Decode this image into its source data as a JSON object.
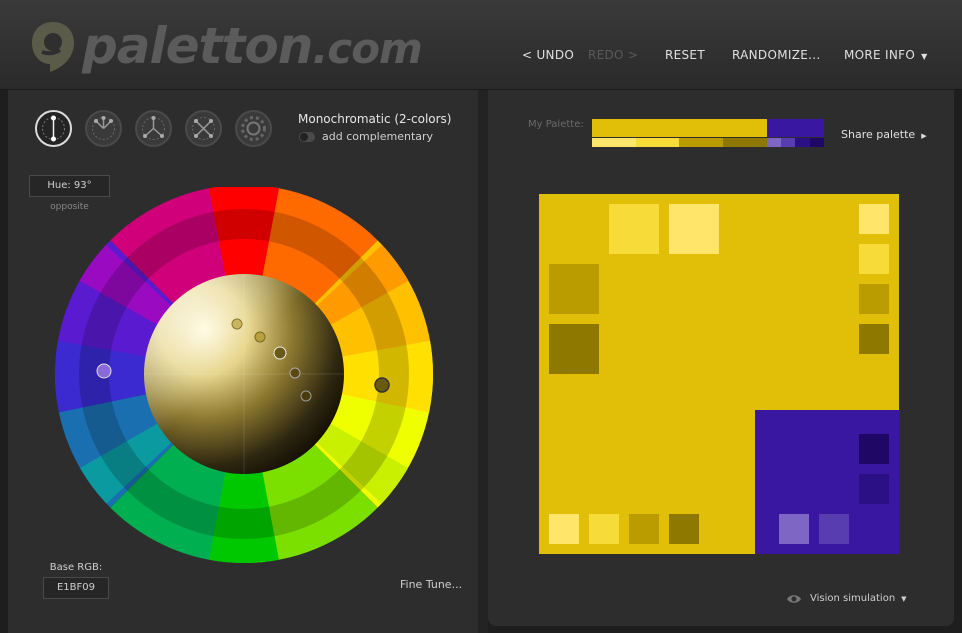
{
  "header": {
    "logo_text": "paletton",
    "logo_tld": ".com",
    "nav": {
      "undo": "< UNDO",
      "redo": "REDO >",
      "reset": "RESET",
      "randomize": "RANDOMIZE...",
      "more_info": "MORE INFO"
    }
  },
  "left": {
    "scheme_buttons": [
      {
        "name": "monochromatic",
        "active": true
      },
      {
        "name": "adjacent",
        "active": false
      },
      {
        "name": "triad",
        "active": false
      },
      {
        "name": "tetrad",
        "active": false
      },
      {
        "name": "free-style",
        "active": false
      }
    ],
    "scheme_title": "Monochromatic (2-colors)",
    "add_complementary": "add complementary",
    "hue": "Hue: 93°",
    "opposite": "opposite",
    "base_rgb_label": "Base RGB:",
    "base_rgb_value": "E1BF09",
    "fine_tune": "Fine Tune..."
  },
  "right": {
    "my_palette_label": "My Palette:",
    "share_palette": "Share palette",
    "vision_simulation": "Vision simulation"
  },
  "colors": {
    "primary": [
      "#E1BF09",
      "#FFE66A",
      "#F7DB38",
      "#BA9C00",
      "#8F7800"
    ],
    "complement": [
      "#3A17A0",
      "#7D66C4",
      "#573DAF",
      "#2A0F85",
      "#1F0865"
    ]
  }
}
